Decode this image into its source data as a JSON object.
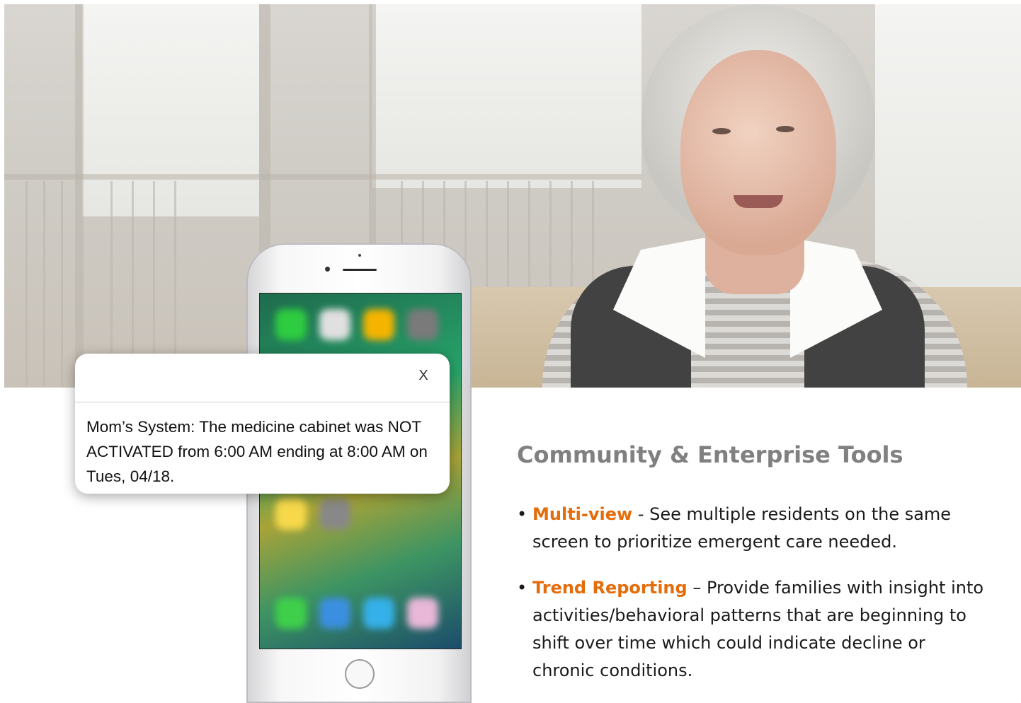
{
  "notification": {
    "close_label": "X",
    "message": "Mom’s System: The medicine cabinet was NOT ACTIVATED from 6:00 AM ending at 8:00 AM on Tues, 04/18."
  },
  "section": {
    "title": "Community & Enterprise Tools",
    "features": [
      {
        "bullet": "•",
        "term": "Multi-view",
        "separator": " - ",
        "line1": "See multiple residents on the same",
        "line2": "screen to prioritize emergent care needed."
      },
      {
        "bullet": "•",
        "term": "Trend Reporting",
        "separator": " – ",
        "line1": "Provide families with insight into",
        "line2": "activities/behavioral patterns that are beginning to",
        "line3": "shift over time which could indicate decline or",
        "line4": "chronic conditions."
      }
    ]
  },
  "colors": {
    "accent": "#e46c0a",
    "title_gray": "#808080"
  }
}
